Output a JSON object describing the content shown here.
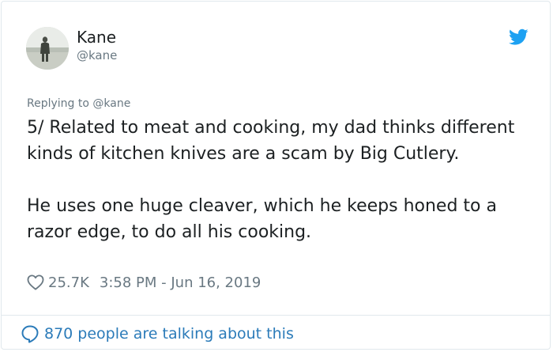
{
  "author": {
    "display_name": "Kane",
    "handle": "@kane",
    "avatar_icon": "person-on-beach-avatar"
  },
  "brand": {
    "icon": "twitter-bird-icon",
    "color": "#1da1f2"
  },
  "tweet": {
    "replying_to": "Replying to @kane",
    "paragraph_1": "5/ Related to meat and cooking, my dad thinks different kinds of kitchen knives are a scam by Big Cutlery.",
    "paragraph_2": "He uses one huge cleaver, which he keeps honed to a razor edge, to do all his cooking.",
    "likes": "25.7K",
    "timestamp": "3:58 PM - Jun 16, 2019"
  },
  "footer": {
    "talking_text": "870 people are talking about this",
    "link_color": "#2b7bb9"
  }
}
